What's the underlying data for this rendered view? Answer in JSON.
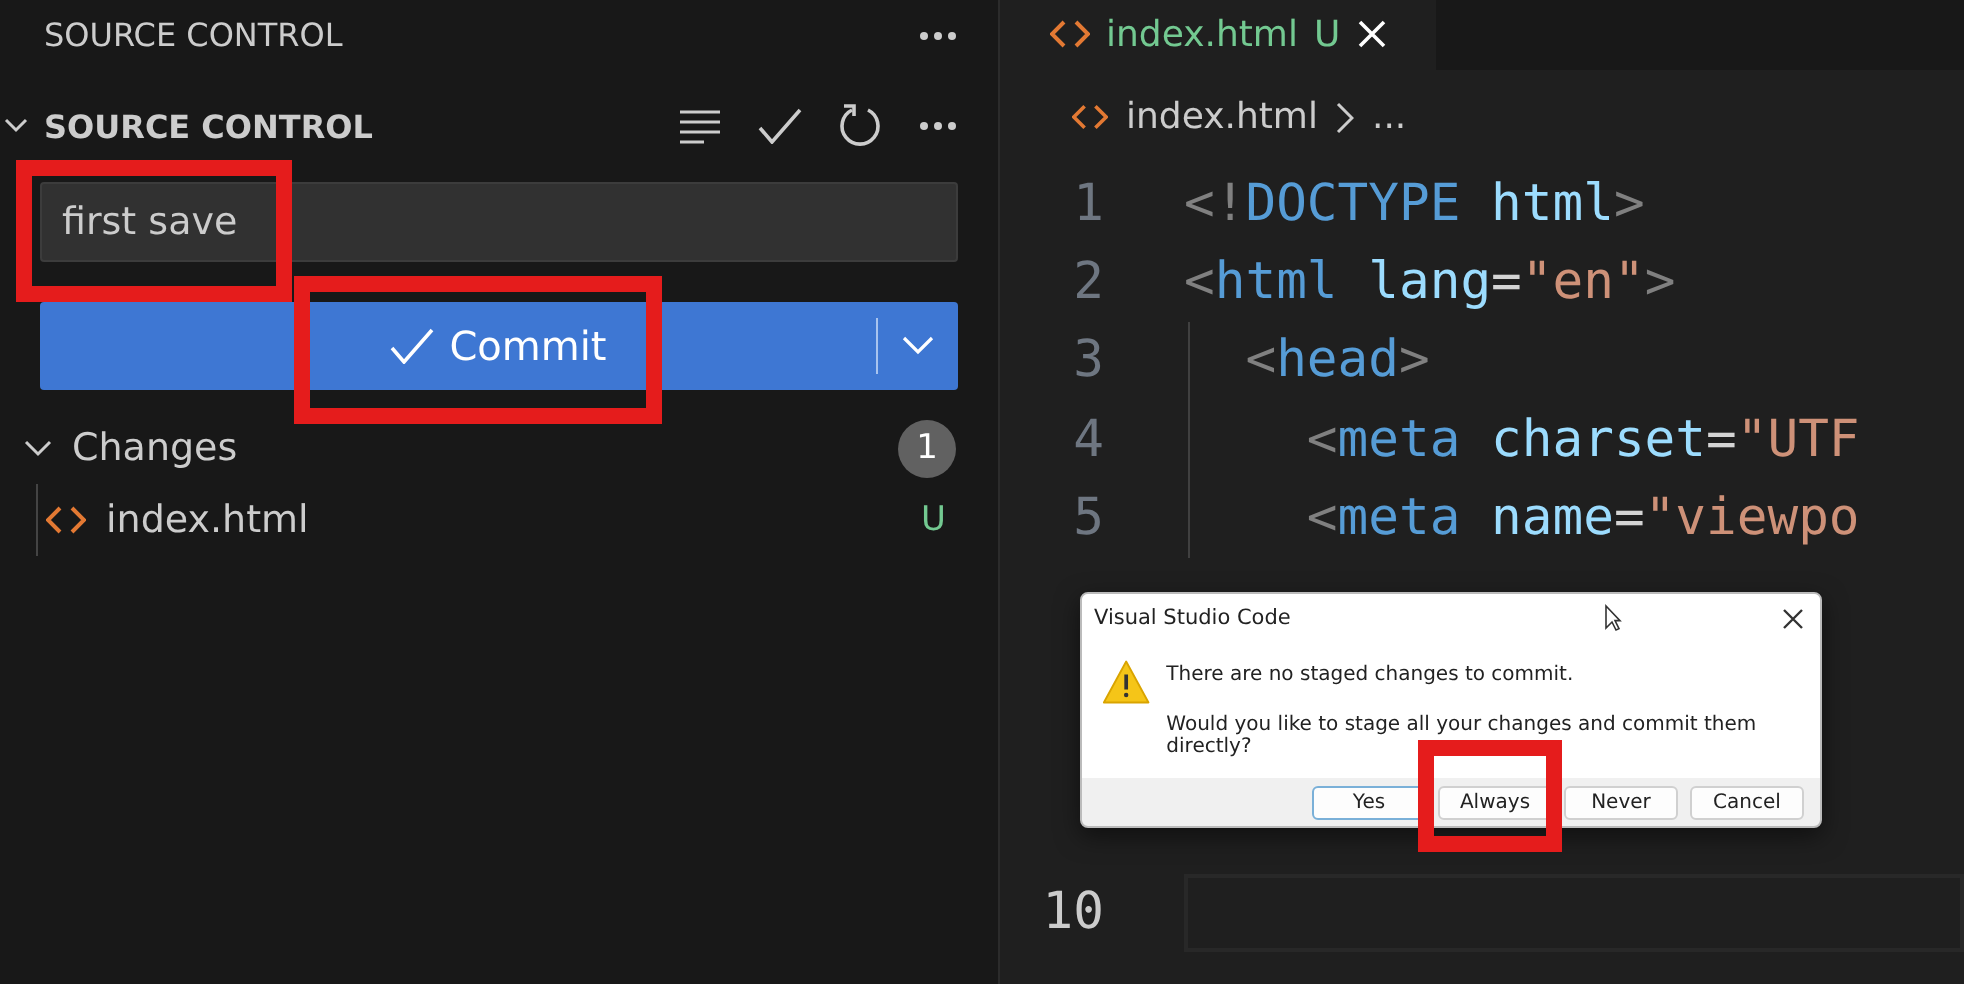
{
  "panel": {
    "title": "SOURCE CONTROL",
    "section": {
      "title": "SOURCE CONTROL",
      "expanded": true
    },
    "commit_message": {
      "value": "first save"
    },
    "commit_button": {
      "label": "Commit"
    },
    "changes": {
      "title": "Changes",
      "expanded": true,
      "count": "1",
      "files": [
        {
          "name": "index.html",
          "status": "U"
        }
      ]
    }
  },
  "tabs": [
    {
      "label": "index.html",
      "status": "U",
      "selected": true
    }
  ],
  "breadcrumb": {
    "file": "index.html",
    "more": "..."
  },
  "editor": {
    "lines": [
      {
        "number": "1",
        "current": false,
        "tokens": [
          {
            "kind": "punct",
            "text": "<!"
          },
          {
            "kind": "tag",
            "text": "DOCTYPE"
          },
          {
            "kind": "attr",
            "text": " html"
          },
          {
            "kind": "punct",
            "text": ">"
          }
        ]
      },
      {
        "number": "2",
        "current": false,
        "tokens": [
          {
            "kind": "punct",
            "text": "<"
          },
          {
            "kind": "tag",
            "text": "html"
          },
          {
            "kind": "attr",
            "text": " lang"
          },
          {
            "kind": "text",
            "text": "="
          },
          {
            "kind": "string",
            "text": "\"en\""
          },
          {
            "kind": "punct",
            "text": ">"
          }
        ]
      },
      {
        "number": "3",
        "current": false,
        "tokens": [
          {
            "kind": "punct",
            "text": "  <"
          },
          {
            "kind": "tag",
            "text": "head"
          },
          {
            "kind": "punct",
            "text": ">"
          }
        ]
      },
      {
        "number": "4",
        "current": false,
        "tokens": [
          {
            "kind": "punct",
            "text": "    <"
          },
          {
            "kind": "tag",
            "text": "meta"
          },
          {
            "kind": "attr",
            "text": " charset"
          },
          {
            "kind": "text",
            "text": "="
          },
          {
            "kind": "string",
            "text": "\"UTF"
          }
        ]
      },
      {
        "number": "5",
        "current": false,
        "tokens": [
          {
            "kind": "punct",
            "text": "    <"
          },
          {
            "kind": "tag",
            "text": "meta"
          },
          {
            "kind": "attr",
            "text": " name"
          },
          {
            "kind": "text",
            "text": "="
          },
          {
            "kind": "string",
            "text": "\"viewpo"
          }
        ]
      },
      {
        "number": "10",
        "current": true
      }
    ]
  },
  "dialog": {
    "title": "Visual Studio Code",
    "message": "There are no staged changes to commit.",
    "detail": "Would you like to stage all your changes and commit them directly?",
    "buttons": [
      {
        "label": "Yes",
        "selected": true
      },
      {
        "label": "Always",
        "selected": false
      },
      {
        "label": "Never",
        "selected": false
      },
      {
        "label": "Cancel",
        "selected": false
      }
    ]
  }
}
